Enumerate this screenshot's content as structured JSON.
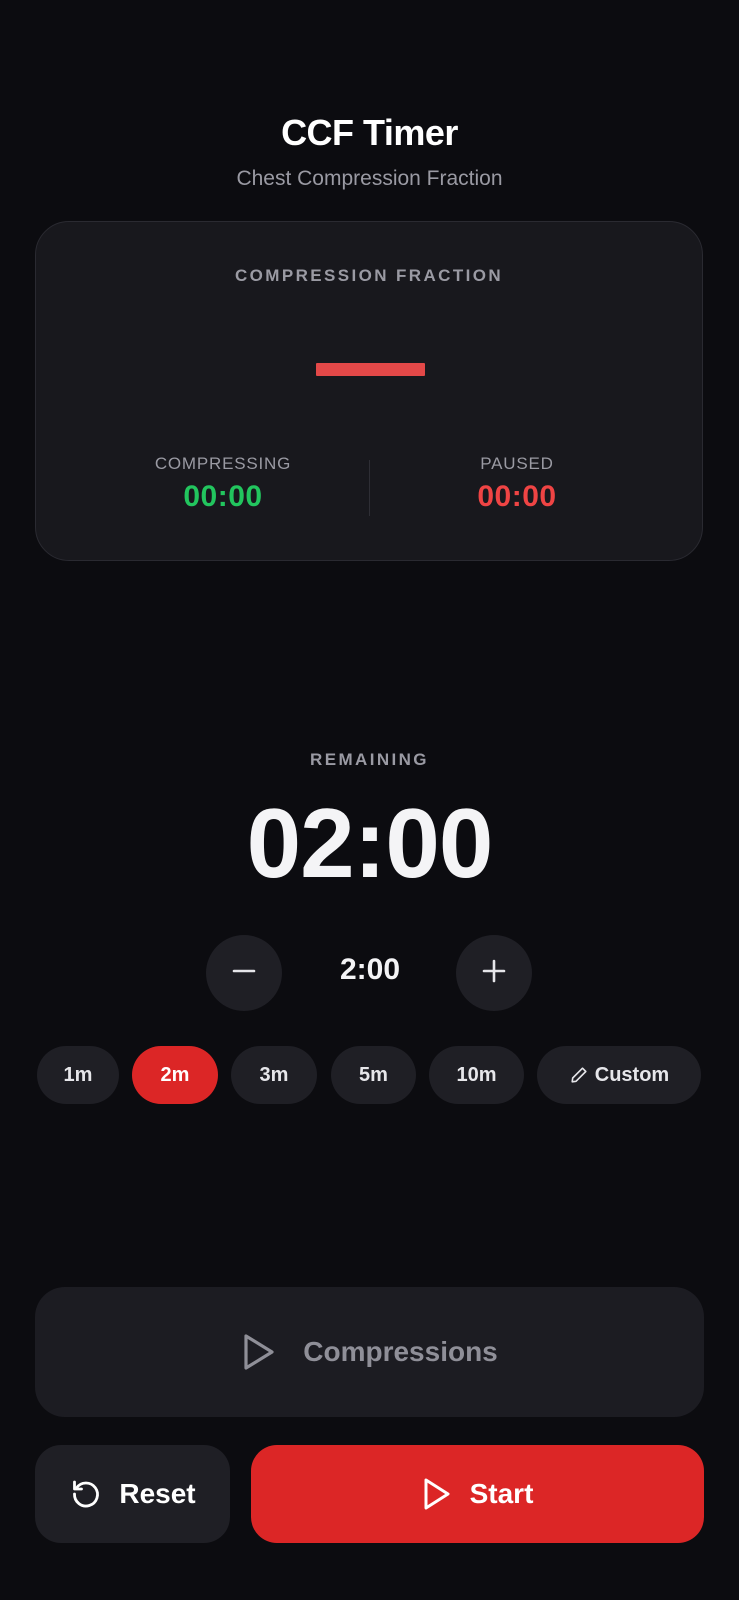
{
  "header": {
    "title": "CCF Timer",
    "subtitle": "Chest Compression Fraction"
  },
  "fraction_card": {
    "label": "COMPRESSION FRACTION",
    "value_placeholder": "—",
    "compressing": {
      "label": "COMPRESSING",
      "value": "00:00"
    },
    "paused": {
      "label": "PAUSED",
      "value": "00:00"
    }
  },
  "timer": {
    "remaining_label": "REMAINING",
    "remaining_value": "02:00",
    "duration_value": "2:00",
    "minus_icon": "minus-icon",
    "plus_icon": "plus-icon"
  },
  "presets": [
    {
      "label": "1m",
      "active": false
    },
    {
      "label": "2m",
      "active": true
    },
    {
      "label": "3m",
      "active": false
    },
    {
      "label": "5m",
      "active": false
    },
    {
      "label": "10m",
      "active": false
    },
    {
      "label": "Custom",
      "active": false,
      "icon": "pencil-icon"
    }
  ],
  "controls": {
    "compressions_label": "Compressions",
    "compressions_icon": "play-icon",
    "reset_label": "Reset",
    "reset_icon": "reset-icon",
    "start_label": "Start",
    "start_icon": "play-icon"
  },
  "colors": {
    "background": "#0c0c10",
    "card": "#18181d",
    "accent_red": "#dc2626",
    "compressing_green": "#22c55e",
    "paused_red": "#ef4444",
    "muted_text": "#9a9aa3"
  }
}
